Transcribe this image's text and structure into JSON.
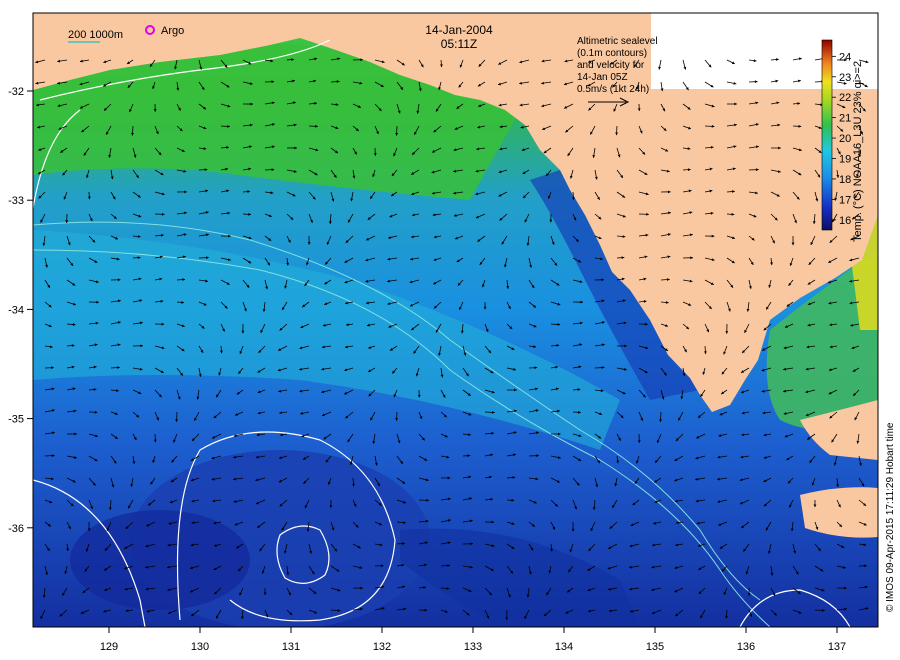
{
  "header": {
    "date": "14-Jan-2004",
    "time": "05:11Z"
  },
  "scale_bar": {
    "label": "200  1000m"
  },
  "legend": {
    "argo_label": "Argo",
    "argo_color": "#e000e0"
  },
  "velocity_note": {
    "line1": "Altimetric sealevel",
    "line2": "(0.1m contours)",
    "line3": "and velocity for",
    "line4": "14-Jan 05Z",
    "line5": "0.5m/s (1kt 24h)"
  },
  "colorbar": {
    "title": "Temp. (°C) NOAA16_L3U 23% qi>=2",
    "ticks": [
      "16",
      "17",
      "18",
      "19",
      "20",
      "21",
      "22",
      "23",
      "24"
    ],
    "range": [
      15.5,
      24.8
    ]
  },
  "axes": {
    "lon_ticks": [
      "129",
      "130",
      "131",
      "132",
      "133",
      "134",
      "135",
      "136",
      "137"
    ],
    "lat_ticks": [
      "-32",
      "-33",
      "-34",
      "-35",
      "-36"
    ]
  },
  "credit": "© IMOS 09-Apr-2015 17:11:29 Hobart time",
  "colors": {
    "land": "#fac8a0",
    "frame": "#000000",
    "contour": "#ffffff",
    "bathymetry": "#80e0e0"
  }
}
